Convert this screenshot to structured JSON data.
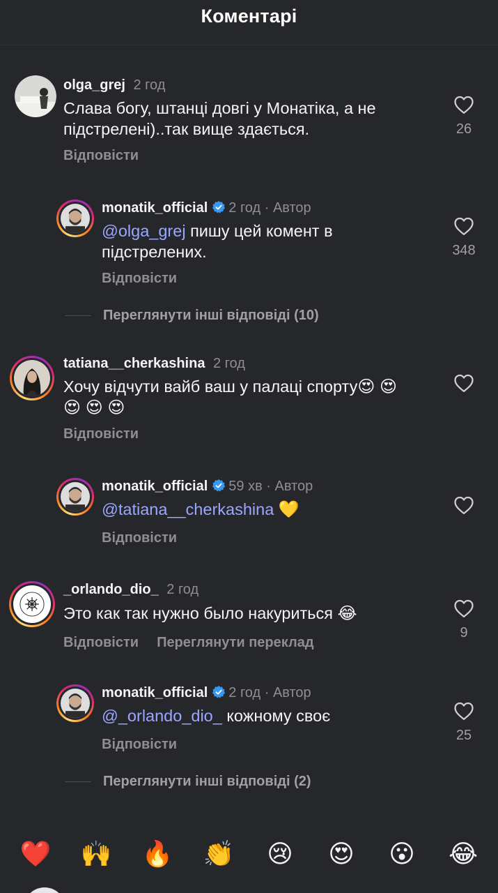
{
  "header": {
    "title": "Коментарі"
  },
  "common": {
    "reply_label": "Відповісти",
    "dot": "·"
  },
  "comments": [
    {
      "username": "olga_grej",
      "time": "2 год",
      "text": "Слава богу, штанці довгі у Монатіка, а не підстрелені)..так вище здається.",
      "likes": "26",
      "translate_label": ""
    },
    {
      "username": "monatik_official",
      "time": "2 год",
      "author": "Автор",
      "mention": "@olga_grej",
      "text": " пишу цей комент в підстрелених.",
      "likes": "348"
    },
    {
      "username": "tatiana__cherkashina",
      "time": "2 год",
      "text": "Хочу відчути вайб ваш у палаці спорту",
      "emoji_line1": "😍 😍",
      "emoji_line2": "😍 😍 😍",
      "likes": ""
    },
    {
      "username": "monatik_official",
      "time": "59 хв",
      "author": "Автор",
      "mention": "@tatiana__cherkashina",
      "emoji": "💛",
      "likes": ""
    },
    {
      "username": "_orlando_dio_",
      "time": "2 год",
      "text": "Это как так нужно было накуриться ",
      "emoji": "😂",
      "likes": "9",
      "translate_label": "Переглянути переклад"
    },
    {
      "username": "monatik_official",
      "time": "2 год",
      "author": "Автор",
      "mention": "@_orlando_dio_",
      "text": " кожному своє",
      "likes": "25"
    }
  ],
  "more_replies": [
    {
      "label": "Переглянути інші відповіді (10)"
    },
    {
      "label": "Переглянути інші відповіді (2)"
    }
  ],
  "reactions": [
    "❤️",
    "🙌",
    "🔥",
    "👏",
    "😢",
    "😍",
    "😮",
    "😂"
  ],
  "colors": {
    "background": "#26272b",
    "mention": "#9aa7ff",
    "secondary_text": "#8e8e93",
    "verified": "#3897f0"
  },
  "icons": {
    "like": "heart-outline-icon",
    "verified": "verified-badge-icon"
  }
}
